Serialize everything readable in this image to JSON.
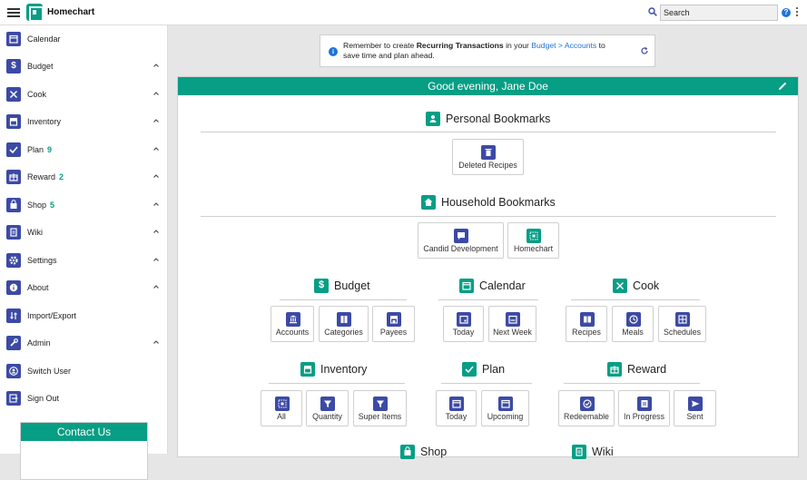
{
  "app": {
    "title": "Homechart"
  },
  "search": {
    "placeholder": "Search"
  },
  "sidebar": {
    "items": [
      {
        "label": "Calendar",
        "icon": "calendar-icon",
        "badge": ""
      },
      {
        "label": "Budget",
        "icon": "dollar-icon",
        "badge": ""
      },
      {
        "label": "Cook",
        "icon": "utensils-icon",
        "badge": ""
      },
      {
        "label": "Inventory",
        "icon": "inventory-icon",
        "badge": ""
      },
      {
        "label": "Plan",
        "icon": "check-icon",
        "badge": "9"
      },
      {
        "label": "Reward",
        "icon": "gift-icon",
        "badge": "2"
      },
      {
        "label": "Shop",
        "icon": "bag-icon",
        "badge": "5"
      },
      {
        "label": "Wiki",
        "icon": "document-icon",
        "badge": ""
      },
      {
        "label": "Settings",
        "icon": "gear-icon",
        "badge": ""
      },
      {
        "label": "About",
        "icon": "info-icon",
        "badge": ""
      },
      {
        "label": "Import/Export",
        "icon": "import-export-icon",
        "badge": ""
      },
      {
        "label": "Admin",
        "icon": "wrench-icon",
        "badge": ""
      },
      {
        "label": "Switch User",
        "icon": "switch-user-icon",
        "badge": ""
      },
      {
        "label": "Sign Out",
        "icon": "sign-out-icon",
        "badge": ""
      }
    ],
    "contact_label": "Contact Us"
  },
  "banner": {
    "prefix": "Remember to create ",
    "bold": "Recurring Transactions",
    "middle": " in your ",
    "link": "Budget > Accounts",
    "suffix": " to save time and plan ahead."
  },
  "main": {
    "greeting": "Good evening, Jane Doe",
    "personal_bookmarks": {
      "title": "Personal Bookmarks",
      "tiles": [
        "Deleted Recipes"
      ]
    },
    "household_bookmarks": {
      "title": "Household Bookmarks",
      "tiles": [
        "Candid Development",
        "Homechart"
      ]
    },
    "budget": {
      "title": "Budget",
      "tiles": [
        "Accounts",
        "Categories",
        "Payees"
      ]
    },
    "calendar": {
      "title": "Calendar",
      "tiles": [
        "Today",
        "Next Week"
      ]
    },
    "cook": {
      "title": "Cook",
      "tiles": [
        "Recipes",
        "Meals",
        "Schedules"
      ]
    },
    "inventory": {
      "title": "Inventory",
      "tiles": [
        "All",
        "Quantity",
        "Super Items"
      ]
    },
    "plan": {
      "title": "Plan",
      "tiles": [
        "Today",
        "Upcoming"
      ]
    },
    "reward": {
      "title": "Reward",
      "tiles": [
        "Redeemable",
        "In Progress",
        "Sent"
      ]
    },
    "shop": {
      "title": "Shop"
    },
    "wiki": {
      "title": "Wiki"
    }
  },
  "colors": {
    "accent": "#069e85",
    "icon_blue": "#3c4aa5",
    "link": "#1e73d8"
  }
}
